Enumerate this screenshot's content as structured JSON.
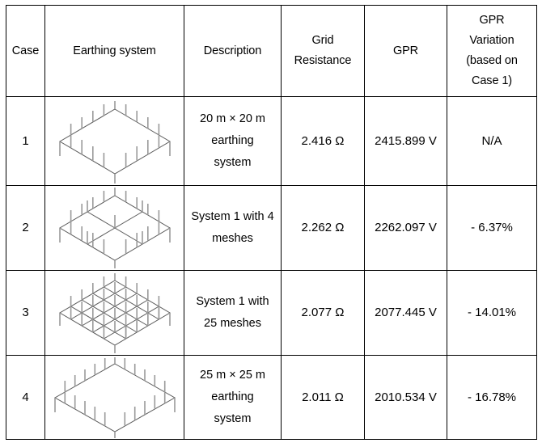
{
  "table": {
    "headers": [
      {
        "id": "case",
        "lines": [
          "Case"
        ]
      },
      {
        "id": "system",
        "lines": [
          "Earthing system"
        ]
      },
      {
        "id": "description",
        "lines": [
          "Description"
        ]
      },
      {
        "id": "resistance",
        "lines": [
          "Grid",
          "Resistance"
        ]
      },
      {
        "id": "gpr",
        "lines": [
          "GPR"
        ]
      },
      {
        "id": "variation",
        "lines": [
          "GPR",
          "Variation",
          "(based on",
          "Case 1)"
        ]
      }
    ],
    "rows": [
      {
        "case": "1",
        "diagram": "isometric-earthing-grid-1x1",
        "description_lines": [
          "20 m × 20 m",
          "earthing",
          "system"
        ],
        "grid_resistance": "2.416 Ω",
        "gpr": "2415.899 V",
        "gpr_variation": "N/A"
      },
      {
        "case": "2",
        "diagram": "isometric-earthing-grid-2x2",
        "description_lines": [
          "System 1 with 4",
          "meshes"
        ],
        "grid_resistance": "2.262 Ω",
        "gpr": "2262.097 V",
        "gpr_variation": "- 6.37%"
      },
      {
        "case": "3",
        "diagram": "isometric-earthing-grid-5x5",
        "description_lines": [
          "System 1 with",
          "25 meshes"
        ],
        "grid_resistance": "2.077 Ω",
        "gpr": "2077.445 V",
        "gpr_variation": "- 14.01%"
      },
      {
        "case": "4",
        "diagram": "isometric-earthing-grid-large",
        "description_lines": [
          "25 m × 25 m",
          "earthing",
          "system"
        ],
        "grid_resistance": "2.011 Ω",
        "gpr": "2010.534 V",
        "gpr_variation": "- 16.78%"
      }
    ]
  },
  "colors": {
    "border": "#000000",
    "mesh_line": "#5a5a5a",
    "rod_line": "#9a9a9a",
    "background": "#ffffff",
    "text": "#000000"
  }
}
